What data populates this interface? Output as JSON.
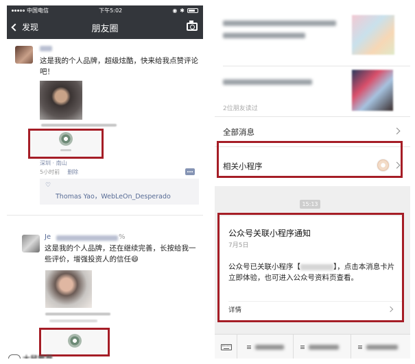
{
  "left_screen": {
    "status": {
      "carrier": "中国电信",
      "time": "下午5:02"
    },
    "nav": {
      "back_label": "发现",
      "title": "朋友圈"
    },
    "post1": {
      "text": "这是我的个人品牌，超级炫酷，快来给我点赞评论吧！",
      "location": "深圳 · 南山",
      "time": "5小时前",
      "delete_label": "删除",
      "likers": "Thomas Yao，WebLeOn_Desperado"
    },
    "post2": {
      "name_prefix": "Je",
      "name_suffix": "%",
      "text": "这是我的个人品牌，还在继续完善，长按给我一些评价，增强投资人的信任😄"
    },
    "watermark": "大鼠推荐"
  },
  "right_screen": {
    "readers_text": "2位朋友读过",
    "rows": {
      "all_messages": "全部消息",
      "related_mini_programs": "相关小程序"
    },
    "time_pill": "15:13",
    "notice": {
      "title": "公众号关联小程序通知",
      "date": "7月5日",
      "body_prefix": "公众号已关联小程序【",
      "body_suffix": "】，点击本消息卡片立即体验，也可进入公众号资料页查看。",
      "detail_label": "详情"
    }
  },
  "colors": {
    "highlight_red": "#a51d26",
    "wechat_link_blue": "#576b95",
    "nav_dark": "#33363b"
  },
  "icons": [
    "back-chevron-icon",
    "camera-icon",
    "heart-icon",
    "comment-icon",
    "keyboard-icon",
    "chevron-right-icon"
  ]
}
